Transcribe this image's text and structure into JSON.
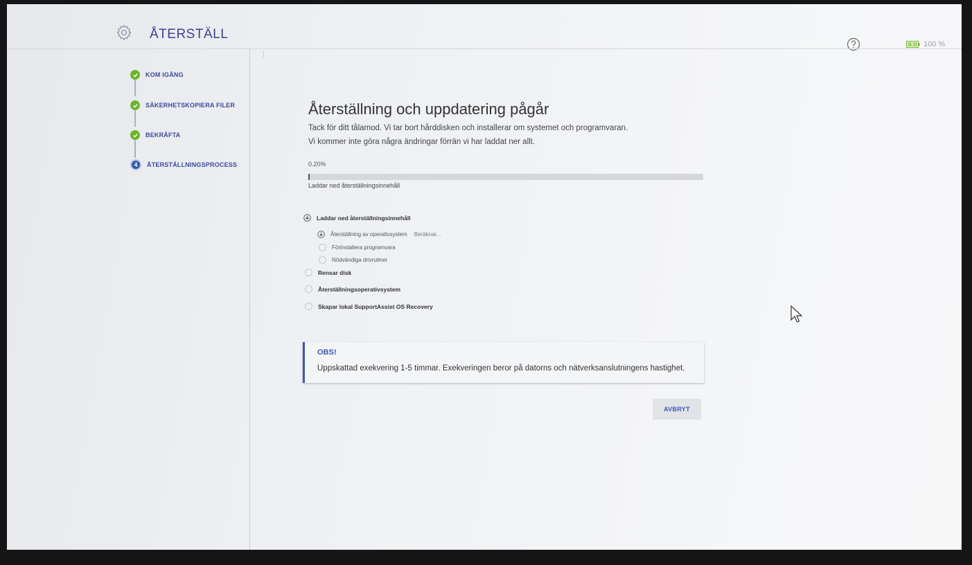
{
  "header": {
    "title": "ÅTERSTÄLL",
    "gear_icon": "gear-icon",
    "help_icon": "question-circle-icon",
    "battery_text": "100 %",
    "battery_color": "#6fb52a"
  },
  "sidebar": {
    "steps": [
      {
        "label": "KOM IGÅNG",
        "state": "done"
      },
      {
        "label": "SÄKERHETSKOPIERA FILER",
        "state": "done"
      },
      {
        "label": "BEKRÄFTA",
        "state": "done"
      },
      {
        "label": "ÅTERSTÄLLNINGSPROCESS",
        "state": "active",
        "number": "4"
      }
    ]
  },
  "main": {
    "heading": "Återställning och uppdatering pågår",
    "description_line1": "Tack för ditt tålamod. Vi tar bort hårddisken och installerar om systemet och programvaran.",
    "description_line2": "Vi kommer inte göra några ändringar förrän vi har laddat ner allt.",
    "progress_text": "0.20%",
    "progress_fraction": 0.002,
    "progress_caption": "Laddar ned återställningsinnehåll",
    "tasks": [
      {
        "label": "Laddar ned återställningsinnehåll",
        "icon": "download-icon",
        "state": "in-progress"
      },
      {
        "label": "Återställning av operativsystem",
        "status": "Beräknar...",
        "icon": "download-icon",
        "state": "in-progress"
      },
      {
        "label": "Förinstallera programvara",
        "icon": "circle-icon",
        "state": "pending"
      },
      {
        "label": "Nödvändiga drivrutiner",
        "icon": "circle-icon",
        "state": "pending"
      },
      {
        "label": "Rensar disk",
        "icon": "circle-icon",
        "state": "pending"
      },
      {
        "label": "Återställningsoperativsystem",
        "icon": "circle-icon",
        "state": "pending"
      },
      {
        "label": "Skapar lokal SupportAssist OS Recovery",
        "icon": "circle-icon",
        "state": "pending"
      }
    ],
    "notice": {
      "title": "OBS!",
      "text": "Uppskattad exekvering 1-5 timmar. Exekveringen beror på datorns och nätverksanslutningens hastighet."
    },
    "cancel_label": "AVBRYT"
  },
  "colors": {
    "accent": "#3b59b0",
    "success": "#6fb52a",
    "title": "#3c3f8d"
  }
}
